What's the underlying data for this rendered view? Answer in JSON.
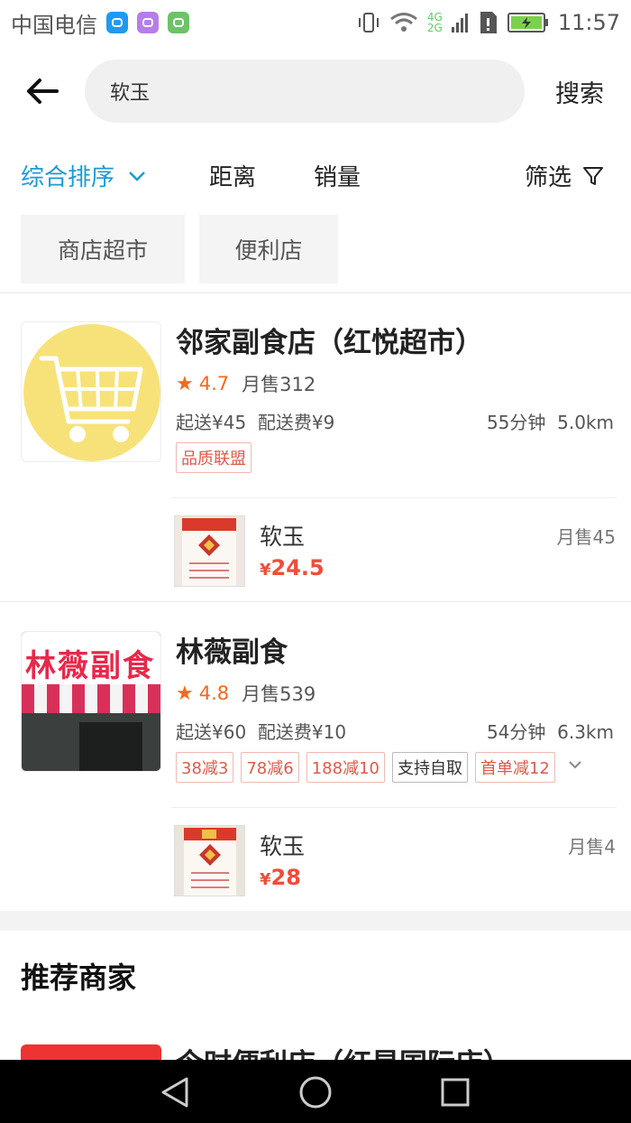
{
  "status_bar": {
    "carrier": "中国电信",
    "network_top": "4G",
    "network_bottom": "2G",
    "time": "11:57"
  },
  "search": {
    "query": "软玉",
    "button_label": "搜索"
  },
  "sort": {
    "items": [
      "综合排序",
      "距离",
      "销量"
    ],
    "filter_label": "筛选",
    "active_color": "#1b9ad6"
  },
  "chips": [
    "商店超市",
    "便利店"
  ],
  "shops": [
    {
      "name": "邻家副食店（红悦超市）",
      "rating": "4.7",
      "monthly_sales": "月售312",
      "min_order": "起送¥45",
      "delivery_fee": "配送费¥9",
      "time": "55分钟",
      "distance": "5.0km",
      "tags": [
        "品质联盟"
      ],
      "product": {
        "name": "软玉",
        "price": "24.5",
        "currency": "¥",
        "sales": "月售45"
      }
    },
    {
      "name": "林薇副食",
      "sign_text": "林薇副食",
      "rating": "4.8",
      "monthly_sales": "月售539",
      "min_order": "起送¥60",
      "delivery_fee": "配送费¥10",
      "time": "54分钟",
      "distance": "6.3km",
      "tags": [
        "38减3",
        "78减6",
        "188减10",
        "支持自取",
        "首单减12"
      ],
      "product": {
        "name": "软玉",
        "price": "28",
        "currency": "¥",
        "sales": "月售4"
      }
    }
  ],
  "recommend": {
    "title": "推荐商家",
    "partial_shop_name": "今时便利店（红星国际店）"
  },
  "colors": {
    "accent": "#1b9ad6",
    "price": "#ef4d3a",
    "rating": "#f26a1b",
    "logo_yellow": "#f7e27a"
  },
  "icons": {
    "back": "arrow-left-icon",
    "filter": "funnel-icon",
    "sort_dropdown": "chevron-down-icon",
    "star": "star-icon",
    "cart": "shopping-cart-icon"
  }
}
